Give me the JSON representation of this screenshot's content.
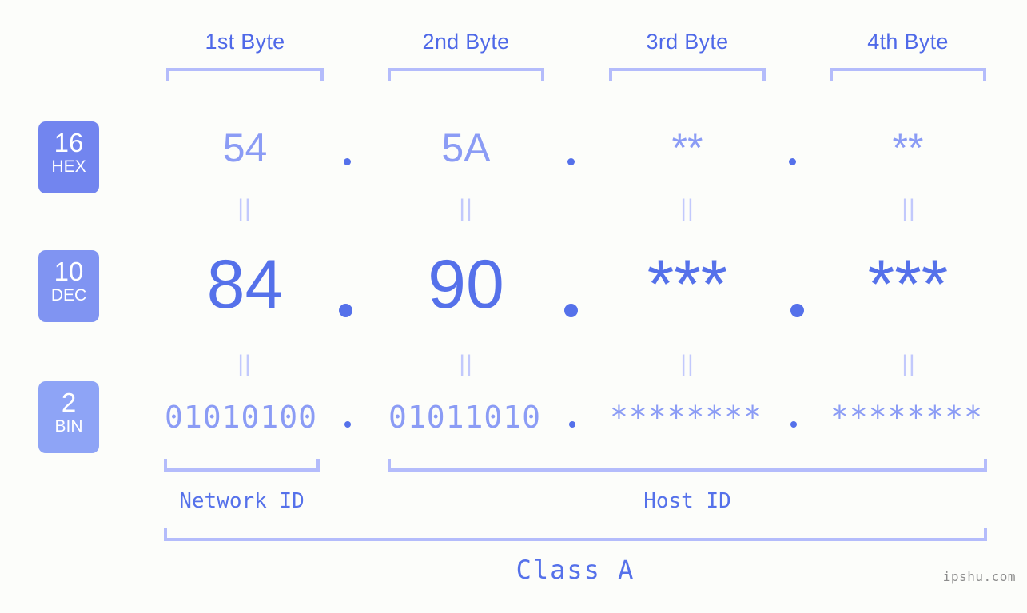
{
  "meta": {
    "background": "#fcfdfa",
    "accent_strong": "#5571ea",
    "accent_mid": "#8b9cf5",
    "accent_light": "#b4bcfb",
    "equals_color": "#c2c9fc"
  },
  "headers": [
    {
      "label": "1st Byte"
    },
    {
      "label": "2nd Byte"
    },
    {
      "label": "3rd Byte"
    },
    {
      "label": "4th Byte"
    }
  ],
  "radix_badges": [
    {
      "number": "16",
      "name": "HEX",
      "color": "#7285ef"
    },
    {
      "number": "10",
      "name": "DEC",
      "color": "#8094f2"
    },
    {
      "number": "2",
      "name": "BIN",
      "color": "#8ea4f6"
    }
  ],
  "rows": {
    "hex": {
      "values": [
        "54",
        "5A",
        "**",
        "**"
      ]
    },
    "dec": {
      "values": [
        "84",
        "90",
        "***",
        "***"
      ]
    },
    "bin": {
      "values": [
        "01010100",
        "01011010",
        "********",
        "********"
      ]
    }
  },
  "separators": {
    "hex": [
      ".",
      ".",
      "."
    ],
    "dec": [
      ".",
      ".",
      "."
    ],
    "bin": [
      ".",
      ".",
      "."
    ]
  },
  "equals_marks": {
    "hex_to_dec": [
      "||",
      "||",
      "||",
      "||"
    ],
    "dec_to_bin": [
      "||",
      "||",
      "||",
      "||"
    ]
  },
  "segments": {
    "network_id": "Network ID",
    "host_id": "Host ID",
    "class": "Class A"
  },
  "watermark": "ipshu.com"
}
